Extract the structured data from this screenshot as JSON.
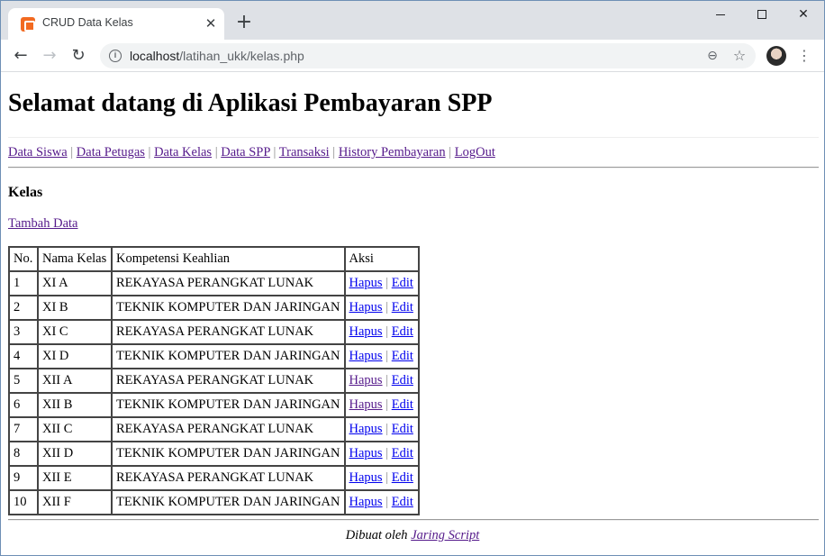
{
  "browser": {
    "tab_title": "CRUD Data Kelas",
    "url_host": "localhost",
    "url_path": "/latihan_ukk/kelas.php"
  },
  "page": {
    "title": "Selamat datang di Aplikasi Pembayaran SPP",
    "nav": [
      {
        "label": "Data Siswa"
      },
      {
        "label": "Data Petugas"
      },
      {
        "label": "Data Kelas"
      },
      {
        "label": "Data SPP"
      },
      {
        "label": "Transaksi"
      },
      {
        "label": "History Pembayaran"
      },
      {
        "label": "LogOut"
      }
    ],
    "nav_separator": "|",
    "section_title": "Kelas",
    "add_link": "Tambah Data",
    "table": {
      "headers": [
        "No.",
        "Nama Kelas",
        "Kompetensi Keahlian",
        "Aksi"
      ],
      "rows": [
        {
          "no": "1",
          "kelas": "XI A",
          "kompetensi": "REKAYASA PERANGKAT LUNAK"
        },
        {
          "no": "2",
          "kelas": "XI B",
          "kompetensi": "TEKNIK KOMPUTER DAN JARINGAN"
        },
        {
          "no": "3",
          "kelas": "XI C",
          "kompetensi": "REKAYASA PERANGKAT LUNAK"
        },
        {
          "no": "4",
          "kelas": "XI D",
          "kompetensi": "TEKNIK KOMPUTER DAN JARINGAN"
        },
        {
          "no": "5",
          "kelas": "XII A",
          "kompetensi": "REKAYASA PERANGKAT LUNAK"
        },
        {
          "no": "6",
          "kelas": "XII B",
          "kompetensi": "TEKNIK KOMPUTER DAN JARINGAN"
        },
        {
          "no": "7",
          "kelas": "XII C",
          "kompetensi": "REKAYASA PERANGKAT LUNAK"
        },
        {
          "no": "8",
          "kelas": "XII D",
          "kompetensi": "TEKNIK KOMPUTER DAN JARINGAN"
        },
        {
          "no": "9",
          "kelas": "XII E",
          "kompetensi": "REKAYASA PERANGKAT LUNAK"
        },
        {
          "no": "10",
          "kelas": "XII F",
          "kompetensi": "TEKNIK KOMPUTER DAN JARINGAN"
        }
      ],
      "action_delete": "Hapus",
      "action_edit": "Edit",
      "action_separator": "|"
    },
    "footer_text": "Dibuat oleh",
    "footer_link": "Jaring Script"
  },
  "colors": {
    "link": "#0000ee",
    "visited_link": "#551a8b"
  }
}
